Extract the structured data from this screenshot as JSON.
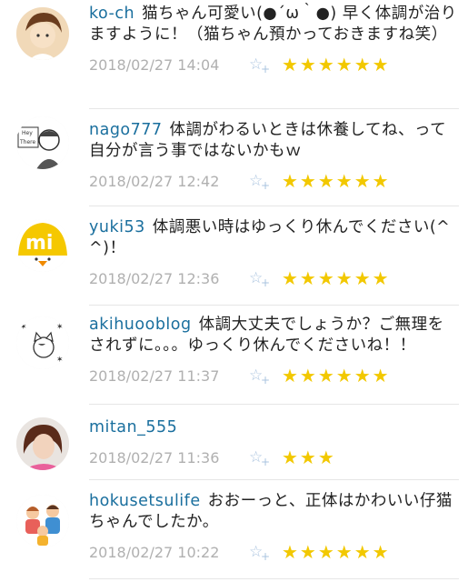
{
  "comments": [
    {
      "user": "ko-ch",
      "text": "猫ちゃん可愛い(●´ω｀●) 早く体調が治りますように！（猫ちゃん預かっておきますね笑）",
      "time": "2018/02/27 14:04",
      "stars": "★★★★★★"
    },
    {
      "user": "nago777",
      "text": "体調がわるいときは休養してね、って自分が言う事ではないかもｗ",
      "time": "2018/02/27 12:42",
      "stars": "★★★★★★"
    },
    {
      "user": "yuki53",
      "text": "体調悪い時はゆっくり休んでください(^^)！",
      "time": "2018/02/27 12:36",
      "stars": "★★★★★★"
    },
    {
      "user": "akihuooblog",
      "text": "体調大丈夫でしょうか？ご無理をされずに。。。ゆっくり休んでくださいね！！",
      "time": "2018/02/27 11:37",
      "stars": "★★★★★★"
    },
    {
      "user": "mitan_555",
      "text": "",
      "time": "2018/02/27 11:36",
      "stars": "★★★"
    },
    {
      "user": "hokusetsulife",
      "text": "おおーっと、正体はかわいい仔猫ちゃんでしたか。",
      "time": "2018/02/27 10:22",
      "stars": "★★★★★★"
    }
  ],
  "icons": {
    "add_star": "star-plus-icon",
    "rating": "star-icon"
  },
  "colors": {
    "username": "#1a6f9e",
    "star": "#f2c800",
    "timestamp": "#b0b0b0",
    "add_star": "#a9c3df"
  }
}
